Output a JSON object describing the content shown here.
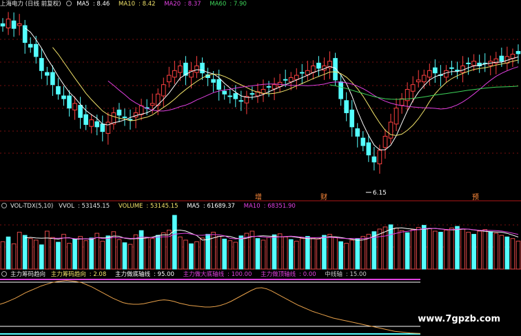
{
  "chart_data": [
    {
      "type": "candlestick",
      "title": "上海电力 (日线 前复权)",
      "indicators": [
        {
          "name": "MA5",
          "value": "8.46",
          "color": "#ffffff"
        },
        {
          "name": "MA10",
          "value": "8.42",
          "color": "#f2e36a"
        },
        {
          "name": "MA20",
          "value": "8.37",
          "color": "#e040e0"
        },
        {
          "name": "MA60",
          "value": "7.90",
          "color": "#3ed65a"
        }
      ],
      "low_marker": "6.15",
      "event_markers": [
        "增",
        "财",
        "预"
      ],
      "up_color": "#ff4040",
      "down_color": "#54ffff",
      "close": [
        9.05,
        9.2,
        9.0,
        9.1,
        8.7,
        8.6,
        8.4,
        8.1,
        8.0,
        7.8,
        7.6,
        7.5,
        7.3,
        7.4,
        7.1,
        6.95,
        7.05,
        6.9,
        6.8,
        7.0,
        7.2,
        7.15,
        7.1,
        7.05,
        7.2,
        7.35,
        7.3,
        7.4,
        7.6,
        7.8,
        8.0,
        8.1,
        8.2,
        8.0,
        8.1,
        8.2,
        8.05,
        7.95,
        7.85,
        7.7,
        7.6,
        7.55,
        7.5,
        7.45,
        7.55,
        7.6,
        7.65,
        7.7,
        7.75,
        7.8,
        7.85,
        7.9,
        7.95,
        8.0,
        8.05,
        8.1,
        8.2,
        8.15,
        8.2,
        8.3,
        7.9,
        7.5,
        7.2,
        6.9,
        6.7,
        6.5,
        6.3,
        6.15,
        6.4,
        6.7,
        7.0,
        7.3,
        7.5,
        7.7,
        7.8,
        7.9,
        8.0,
        8.1,
        8.05,
        8.0,
        8.1,
        8.15,
        8.1,
        8.2,
        8.25,
        8.3,
        8.2,
        8.25,
        8.3,
        8.35,
        8.3,
        8.4,
        8.45,
        8.46
      ]
    },
    {
      "type": "bar",
      "title": "VOL-TDX(5,10)",
      "indicators": [
        {
          "name": "VVOL",
          "value": "53145.15",
          "color": "#e6e6e6"
        },
        {
          "name": "VOLUME",
          "value": "53145.15",
          "color": "#f2e36a"
        },
        {
          "name": "MA5",
          "value": "61689.37",
          "color": "#ffffff"
        },
        {
          "name": "MA10",
          "value": "68351.90",
          "color": "#e040e0"
        }
      ],
      "values": [
        52000,
        61000,
        48000,
        70000,
        64000,
        58000,
        55000,
        46000,
        72000,
        60000,
        51000,
        66000,
        49000,
        57000,
        62000,
        54000,
        59000,
        68000,
        53000,
        63000,
        71000,
        56000,
        50000,
        47000,
        65000,
        73000,
        60000,
        58000,
        64000,
        69000,
        74000,
        102000,
        61000,
        55000,
        48000,
        52000,
        59000,
        66000,
        70000,
        62000,
        57000,
        54000,
        51000,
        63000,
        68000,
        72000,
        58000,
        55000,
        60000,
        65000,
        67000,
        61000,
        56000,
        53000,
        58000,
        62000,
        59000,
        57000,
        64000,
        66000,
        60000,
        52000,
        49000,
        55000,
        58000,
        62000,
        66000,
        71000,
        76000,
        80000,
        84000,
        78000,
        73000,
        69000,
        75000,
        79000,
        83000,
        77000,
        72000,
        70000,
        74000,
        78000,
        81000,
        76000,
        70000,
        66000,
        72000,
        75000,
        71000,
        68000,
        64000,
        61000,
        58000,
        53145
      ]
    },
    {
      "type": "line",
      "title": "主力筹码趋向",
      "indicators": [
        {
          "name": "主力筹码趋向",
          "value": "2.08",
          "color": "#f2e36a"
        },
        {
          "name": "主力做底轴线",
          "value": "95.00",
          "color": "#ffffff"
        },
        {
          "name": "主力做大底轴线",
          "value": "100.00",
          "color": "#e040e0"
        },
        {
          "name": "主力做顶轴线",
          "value": "0.00",
          "color": "#c8c8c8"
        },
        {
          "name": "中线轴",
          "value": "15.00",
          "color": "#c8c8c8"
        }
      ],
      "values": [
        55,
        58,
        62,
        66,
        71,
        76,
        80,
        84,
        88,
        91,
        94,
        96,
        97,
        98,
        97,
        96,
        94,
        90,
        86,
        81,
        76,
        71,
        66,
        62,
        58,
        56,
        55,
        55,
        56,
        58,
        60,
        62,
        63,
        62,
        60,
        57,
        55,
        53,
        52,
        51,
        50,
        50,
        51,
        53,
        56,
        60,
        65,
        70,
        75,
        80,
        84,
        85,
        83,
        79,
        74,
        69,
        64,
        59,
        54,
        50,
        46,
        42,
        39,
        36,
        33,
        30,
        28,
        26,
        24,
        22,
        20,
        18,
        16,
        14,
        12,
        10,
        8,
        6,
        5,
        4,
        3,
        2.5,
        2.08
      ]
    }
  ],
  "watermark": "www.7gpzb.com"
}
